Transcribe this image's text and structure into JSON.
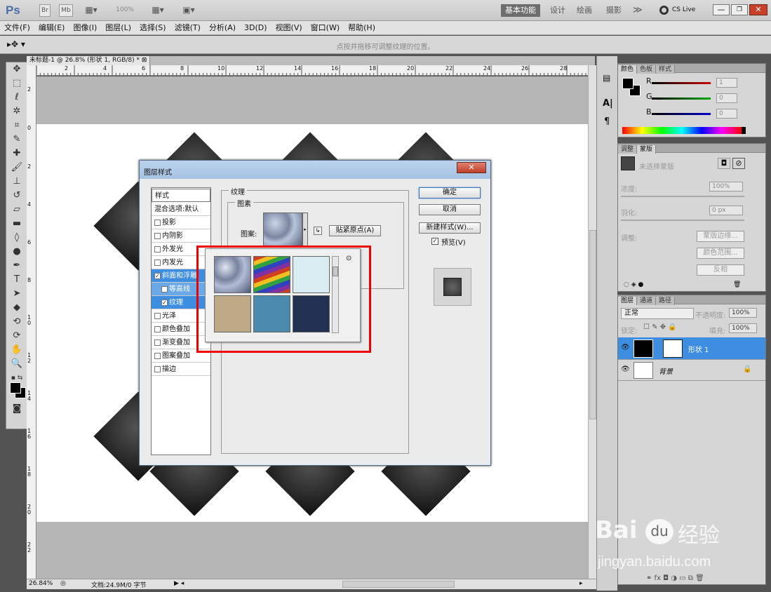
{
  "app": {
    "logo": "Ps",
    "mb": "Mb",
    "zoom": "100%",
    "workspaces": [
      "基本功能",
      "设计",
      "绘画",
      "摄影"
    ],
    "more": "≫",
    "cslive": "CS Live"
  },
  "menu": [
    "文件(F)",
    "编辑(E)",
    "图像(I)",
    "图层(L)",
    "选择(S)",
    "滤镜(T)",
    "分析(A)",
    "3D(D)",
    "视图(V)",
    "窗口(W)",
    "帮助(H)"
  ],
  "options_hint": "点按并拖移可调整纹理的位置。",
  "document": {
    "tab": "未标题-1 @ 26.8% (形状 1, RGB/8) * ⊠",
    "hruler": [
      "2",
      "4",
      "6",
      "8",
      "10",
      "12",
      "14",
      "16",
      "18",
      "20",
      "22",
      "24",
      "26",
      "28"
    ],
    "vruler": [
      "2",
      "0",
      "2",
      "4",
      "6",
      "8",
      "1 0",
      "1 2",
      "1 4",
      "1 6",
      "1 8",
      "2 0",
      "2 2"
    ]
  },
  "status": {
    "zoom": "26.84%",
    "doc": "文档:24.9M/0 字节"
  },
  "dialog": {
    "title": "图层样式",
    "styles_header": "样式",
    "blend": "混合选项:默认",
    "items": [
      {
        "label": "投影",
        "checked": false,
        "selected": false,
        "sub": false
      },
      {
        "label": "内阴影",
        "checked": false,
        "selected": false,
        "sub": false
      },
      {
        "label": "外发光",
        "checked": false,
        "selected": false,
        "sub": false
      },
      {
        "label": "内发光",
        "checked": false,
        "selected": false,
        "sub": false
      },
      {
        "label": "斜面和浮雕",
        "checked": true,
        "selected": true,
        "sub": false
      },
      {
        "label": "等高线",
        "checked": false,
        "selected": true,
        "sub": true
      },
      {
        "label": "纹理",
        "checked": true,
        "selected": true,
        "sub": true
      },
      {
        "label": "光泽",
        "checked": false,
        "selected": false,
        "sub": false
      },
      {
        "label": "颜色叠加",
        "checked": false,
        "selected": false,
        "sub": false
      },
      {
        "label": "渐变叠加",
        "checked": false,
        "selected": false,
        "sub": false
      },
      {
        "label": "图案叠加",
        "checked": false,
        "selected": false,
        "sub": false
      },
      {
        "label": "描边",
        "checked": false,
        "selected": false,
        "sub": false
      }
    ],
    "texture_group": "纹理",
    "pattern_group": "图素",
    "pattern_label": "图案:",
    "snap_button": "贴紧原点(A)",
    "ok": "确定",
    "cancel": "取消",
    "new_style": "新建样式(W)...",
    "preview": "预览(V)"
  },
  "panels": {
    "color_tabs": [
      "颜色",
      "色板",
      "样式"
    ],
    "rgb": [
      {
        "label": "R",
        "value": "1",
        "color": "#cc0000"
      },
      {
        "label": "G",
        "value": "0",
        "color": "#00aa00"
      },
      {
        "label": "B",
        "value": "0",
        "color": "#0000cc"
      }
    ],
    "adj_tabs": [
      "调整",
      "蒙版"
    ],
    "mask_none": "未选择蒙版",
    "density_label": "浓度:",
    "density": "100%",
    "feather_label": "羽化:",
    "feather": "0 px",
    "refine_label": "调整:",
    "mask_edge": "蒙版边缘...",
    "color_range": "颜色范围...",
    "invert": "反相",
    "layer_tabs": [
      "图层",
      "通道",
      "路径"
    ],
    "blend_mode": "正常",
    "opacity_label": "不透明度:",
    "opacity": "100%",
    "lock_label": "锁定:",
    "fill_label": "填充:",
    "fill": "100%",
    "layers": [
      {
        "name": "形状 1",
        "selected": true
      },
      {
        "name": "背景",
        "selected": false
      }
    ]
  },
  "watermark": {
    "brand": "Bai",
    "du": "du",
    "cn": "经验",
    "url": "jingyan.baidu.com"
  }
}
